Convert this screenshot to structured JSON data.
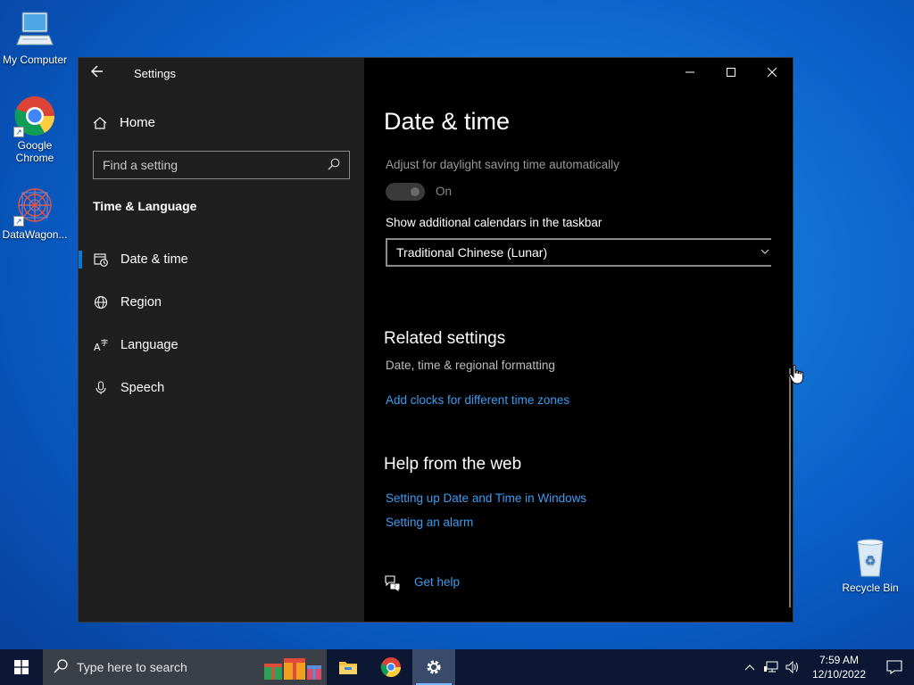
{
  "desktop": {
    "icons": [
      {
        "label": "My Computer",
        "icon": "monitor-icon"
      },
      {
        "label": "Google Chrome",
        "icon": "chrome-icon"
      },
      {
        "label": "DataWagon...",
        "icon": "datawagon-icon"
      },
      {
        "label": "Recycle Bin",
        "icon": "recycle-bin-icon"
      }
    ]
  },
  "window": {
    "app_title": "Settings",
    "controls": {
      "minimize": "–",
      "maximize": "☐",
      "close": "✕"
    }
  },
  "sidebar": {
    "home_label": "Home",
    "search_placeholder": "Find a setting",
    "group_heading": "Time & Language",
    "items": [
      {
        "label": "Date & time",
        "icon": "clock-calendar-icon",
        "active": true
      },
      {
        "label": "Region",
        "icon": "globe-icon",
        "active": false
      },
      {
        "label": "Language",
        "icon": "language-icon",
        "active": false
      },
      {
        "label": "Speech",
        "icon": "microphone-icon",
        "active": false
      }
    ]
  },
  "main": {
    "title": "Date & time",
    "dst_label": "Adjust for daylight saving time automatically",
    "dst_toggle": {
      "state": "On",
      "on": true,
      "disabled": true
    },
    "calendars_label": "Show additional calendars in the taskbar",
    "calendars_value": "Traditional Chinese (Lunar)",
    "related": {
      "heading": "Related settings",
      "sub": "Date, time & regional formatting",
      "link": "Add clocks for different time zones"
    },
    "help": {
      "heading": "Help from the web",
      "links": [
        "Setting up Date and Time in Windows",
        "Setting an alarm"
      ]
    },
    "get_help": "Get help"
  },
  "taskbar": {
    "search_placeholder": "Type here to search",
    "apps": [
      {
        "name": "file-explorer",
        "icon": "folder-icon"
      },
      {
        "name": "chrome",
        "icon": "chrome-icon"
      },
      {
        "name": "settings",
        "icon": "gear-icon",
        "active": true
      }
    ],
    "clock": {
      "time": "7:59 AM",
      "date": "12/10/2022"
    }
  },
  "colors": {
    "accent": "#0a78d4",
    "link": "#3b9cf0",
    "sidebar_bg": "#1f1f1f",
    "content_bg": "#000000",
    "taskbar_bg": "#0b1733"
  }
}
